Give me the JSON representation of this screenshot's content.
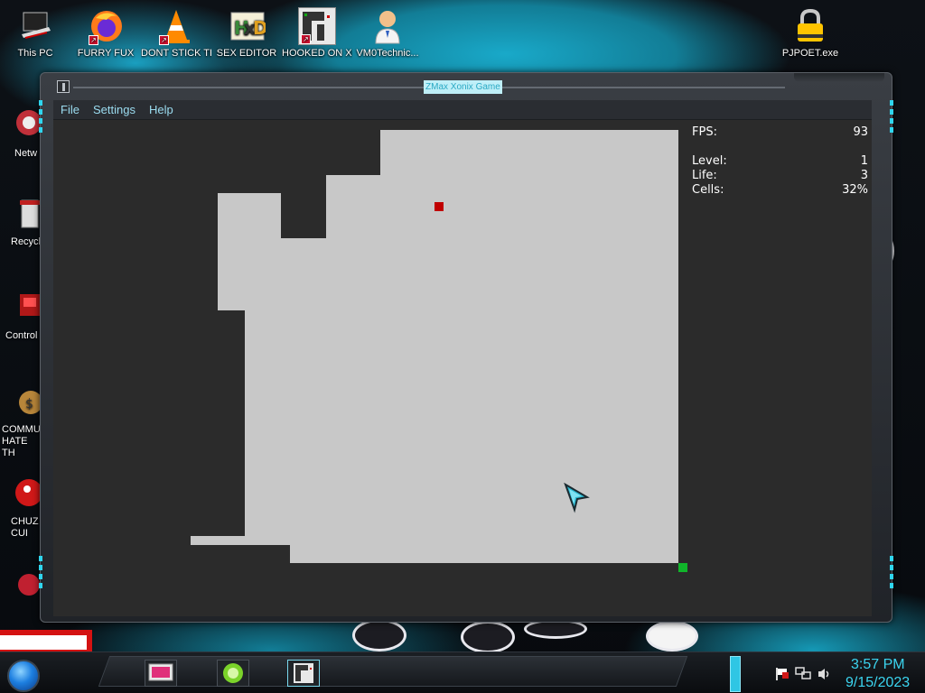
{
  "desktop": {
    "icons": [
      {
        "label": "This PC",
        "icon": "computer-icon"
      },
      {
        "label": "FURRY FUX",
        "icon": "firefox-icon"
      },
      {
        "label": "DONT STICK THIS IN YO",
        "icon": "vlc-cone-icon"
      },
      {
        "label": "SEX EDITOR",
        "icon": "hxd-icon"
      },
      {
        "label": "HOOKED ON XONIX",
        "icon": "xonix-icon"
      },
      {
        "label": "VM0Technic...",
        "icon": "doctor-icon"
      },
      {
        "label": "PJPOET.exe",
        "icon": "lock-icon"
      }
    ],
    "left_icons": [
      {
        "label": "Netw",
        "icon": "network-icon"
      },
      {
        "label": "Recycl",
        "icon": "recycle-bin-icon"
      },
      {
        "label": "Control",
        "icon": "control-panel-icon"
      },
      {
        "label": "COMMU HATE TH",
        "icon": "money-bag-icon"
      },
      {
        "label": "CHUZ CUI",
        "icon": "red-creature-icon"
      }
    ]
  },
  "window": {
    "title": "ZMax Xonix Game",
    "menu": [
      "File",
      "Settings",
      "Help"
    ]
  },
  "stats": {
    "fps_label": "FPS:",
    "fps_value": "93",
    "level_label": "Level:",
    "level_value": "1",
    "life_label": "Life:",
    "life_value": "3",
    "cells_label": "Cells:",
    "cells_value": "32%"
  },
  "game": {
    "colors": {
      "background": "#2b2b2b",
      "filled": "#c8c8c8",
      "enemy": "#c00000",
      "player": "#10b52a"
    }
  },
  "taskbar": {
    "time": "3:57 PM",
    "date": "9/15/2023",
    "tray_icons": [
      "flag-icon",
      "network-icon",
      "volume-icon"
    ]
  }
}
